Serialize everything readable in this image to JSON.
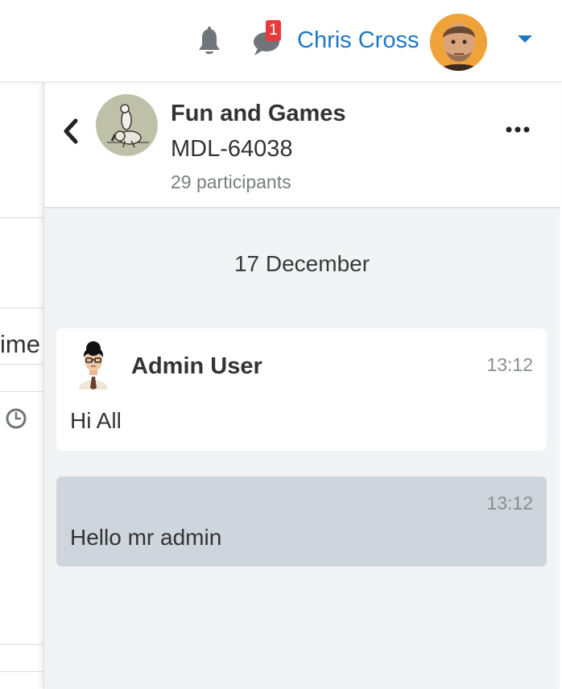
{
  "navbar": {
    "notifications_icon": "bell-icon",
    "messages_icon": "speech-bubble-icon",
    "messages_badge": "1",
    "user_name": "Chris Cross",
    "menu_icon": "caret-down-icon",
    "accent_color": "#1f77c4",
    "badge_color": "#e73b3b"
  },
  "background_page": {
    "header_fragment": "ime",
    "icon": "clock-icon"
  },
  "drawer": {
    "back_icon": "chevron-left-icon",
    "conversation": {
      "title": "Fun and Games",
      "subtitle": "MDL-64038",
      "participants": "29 participants"
    },
    "more_icon": "ellipsis-icon",
    "day_label": "17 December",
    "messages": [
      {
        "sender": "Admin User",
        "time": "13:12",
        "text": "Hi All",
        "own": false
      },
      {
        "time": "13:12",
        "text": "Hello mr admin",
        "own": true
      }
    ],
    "colors": {
      "panel_bg": "#f2f3f5",
      "received_bg": "#ffffff",
      "sent_bg": "#ced5dc"
    }
  }
}
